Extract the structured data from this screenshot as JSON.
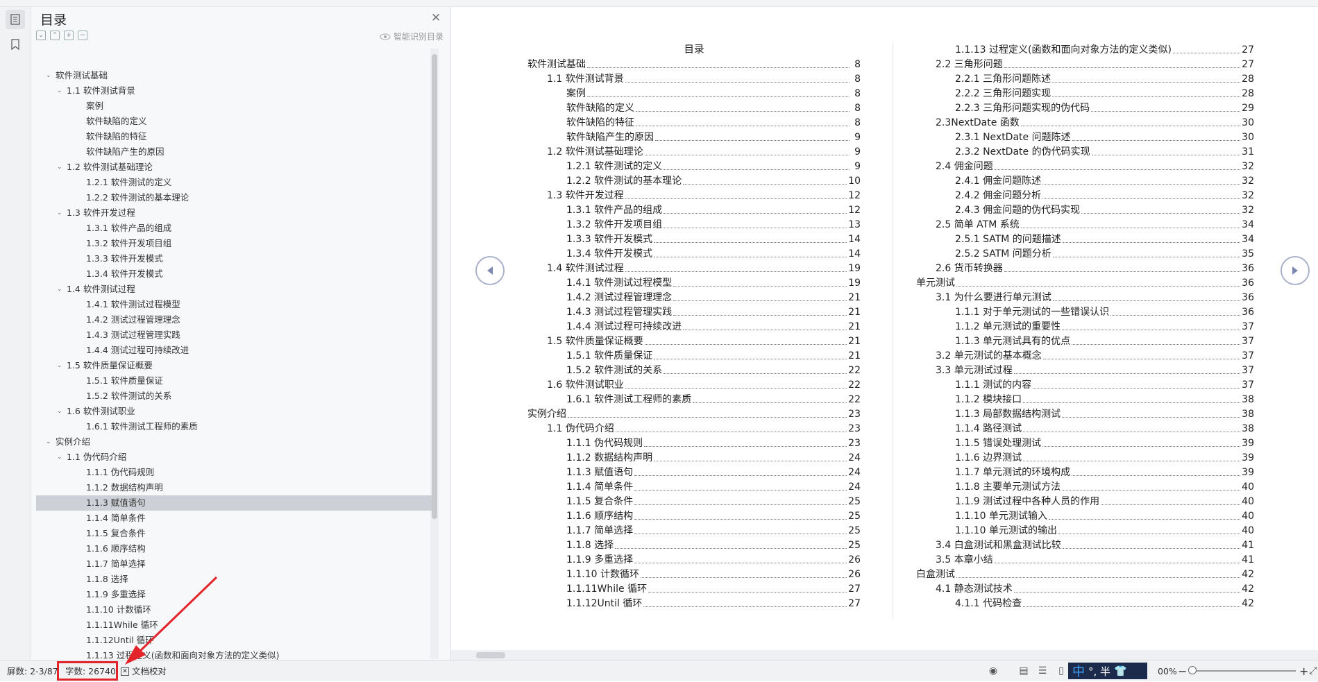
{
  "nav": {
    "title": "目录",
    "close_icon": "close-icon",
    "auto_label": "智能识别目录",
    "tools": [
      "collapse-all-icon",
      "expand-all-icon",
      "add-heading-icon",
      "remove-heading-icon"
    ],
    "items": [
      {
        "level": 0,
        "caret": "open",
        "label": "软件测试基础"
      },
      {
        "level": 1,
        "caret": "open",
        "label": "1.1 软件测试背景"
      },
      {
        "level": 2,
        "caret": "none",
        "label": "案例"
      },
      {
        "level": 2,
        "caret": "none",
        "label": "软件缺陷的定义"
      },
      {
        "level": 2,
        "caret": "none",
        "label": "软件缺陷的特征"
      },
      {
        "level": 2,
        "caret": "none",
        "label": "软件缺陷产生的原因"
      },
      {
        "level": 1,
        "caret": "open",
        "label": "1.2  软件测试基础理论"
      },
      {
        "level": 2,
        "caret": "none",
        "label": "1.2.1 软件测试的定义"
      },
      {
        "level": 2,
        "caret": "none",
        "label": "1.2.2 软件测试的基本理论"
      },
      {
        "level": 1,
        "caret": "open",
        "label": "1.3 软件开发过程"
      },
      {
        "level": 2,
        "caret": "none",
        "label": "1.3.1 软件产品的组成"
      },
      {
        "level": 2,
        "caret": "none",
        "label": "1.3.2 软件开发项目组"
      },
      {
        "level": 2,
        "caret": "none",
        "label": "1.3.3 软件开发模式"
      },
      {
        "level": 2,
        "caret": "none",
        "label": "1.3.4 软件开发模式"
      },
      {
        "level": 1,
        "caret": "open",
        "label": "1.4 软件测试过程"
      },
      {
        "level": 2,
        "caret": "none",
        "label": "1.4.1 软件测试过程模型"
      },
      {
        "level": 2,
        "caret": "none",
        "label": "1.4.2 测试过程管理理念"
      },
      {
        "level": 2,
        "caret": "none",
        "label": "1.4.3 测试过程管理实践"
      },
      {
        "level": 2,
        "caret": "none",
        "label": "1.4.4 测试过程可持续改进"
      },
      {
        "level": 1,
        "caret": "open",
        "label": "1.5 软件质量保证概要"
      },
      {
        "level": 2,
        "caret": "none",
        "label": "1.5.1 软件质量保证"
      },
      {
        "level": 2,
        "caret": "none",
        "label": "1.5.2 软件测试的关系"
      },
      {
        "level": 1,
        "caret": "open",
        "label": "1.6 软件测试职业"
      },
      {
        "level": 2,
        "caret": "none",
        "label": "1.6.1 软件测试工程师的素质"
      },
      {
        "level": 0,
        "caret": "open",
        "label": "实例介绍"
      },
      {
        "level": 1,
        "caret": "open",
        "label": "1.1 伪代码介绍"
      },
      {
        "level": 2,
        "caret": "none",
        "label": "1.1.1 伪代码规则"
      },
      {
        "level": 2,
        "caret": "none",
        "label": "1.1.2 数据结构声明"
      },
      {
        "level": 2,
        "caret": "none",
        "label": "1.1.3 赋值语句",
        "selected": true
      },
      {
        "level": 2,
        "caret": "none",
        "label": "1.1.4 简单条件"
      },
      {
        "level": 2,
        "caret": "none",
        "label": "1.1.5 复合条件"
      },
      {
        "level": 2,
        "caret": "none",
        "label": "1.1.6 顺序结构"
      },
      {
        "level": 2,
        "caret": "none",
        "label": "1.1.7 简单选择"
      },
      {
        "level": 2,
        "caret": "none",
        "label": "1.1.8 选择"
      },
      {
        "level": 2,
        "caret": "none",
        "label": "1.1.9 多重选择"
      },
      {
        "level": 2,
        "caret": "none",
        "label": "1.1.10 计数循环"
      },
      {
        "level": 2,
        "caret": "none",
        "label": "1.1.11While 循环"
      },
      {
        "level": 2,
        "caret": "none",
        "label": "1.1.12Until 循环"
      },
      {
        "level": 2,
        "caret": "none",
        "label": "1.1.13 过程定义(函数和面向对象方法的定义类似)"
      }
    ]
  },
  "page": {
    "toc_title": "目录",
    "left": [
      {
        "level": 0,
        "text": "软件测试基础",
        "page": "8"
      },
      {
        "level": 1,
        "text": "1.1 软件测试背景",
        "page": "8"
      },
      {
        "level": 2,
        "text": "案例",
        "page": "8"
      },
      {
        "level": 2,
        "text": "软件缺陷的定义",
        "page": "8"
      },
      {
        "level": 2,
        "text": "软件缺陷的特征",
        "page": "8"
      },
      {
        "level": 2,
        "text": "软件缺陷产生的原因",
        "page": "9"
      },
      {
        "level": 1,
        "text": "1.2  软件测试基础理论",
        "page": "9"
      },
      {
        "level": 2,
        "text": "1.2.1 软件测试的定义",
        "page": "9"
      },
      {
        "level": 2,
        "text": "1.2.2 软件测试的基本理论",
        "page": "10"
      },
      {
        "level": 1,
        "text": "1.3 软件开发过程",
        "page": "12"
      },
      {
        "level": 2,
        "text": "1.3.1 软件产品的组成",
        "page": "12"
      },
      {
        "level": 2,
        "text": "1.3.2 软件开发项目组",
        "page": "13"
      },
      {
        "level": 2,
        "text": "1.3.3 软件开发模式",
        "page": "14"
      },
      {
        "level": 2,
        "text": "1.3.4 软件开发模式",
        "page": "14"
      },
      {
        "level": 1,
        "text": "1.4 软件测试过程",
        "page": "19"
      },
      {
        "level": 2,
        "text": "1.4.1 软件测试过程模型",
        "page": "19"
      },
      {
        "level": 2,
        "text": "1.4.2 测试过程管理理念",
        "page": "21"
      },
      {
        "level": 2,
        "text": "1.4.3 测试过程管理实践",
        "page": "21"
      },
      {
        "level": 2,
        "text": "1.4.4 测试过程可持续改进",
        "page": "21"
      },
      {
        "level": 1,
        "text": "1.5 软件质量保证概要",
        "page": "21"
      },
      {
        "level": 2,
        "text": "1.5.1 软件质量保证",
        "page": "21"
      },
      {
        "level": 2,
        "text": "1.5.2 软件测试的关系",
        "page": "22"
      },
      {
        "level": 1,
        "text": "1.6 软件测试职业",
        "page": "22"
      },
      {
        "level": 2,
        "text": "1.6.1 软件测试工程师的素质",
        "page": "22"
      },
      {
        "level": 0,
        "text": "实例介绍",
        "page": "23"
      },
      {
        "level": 1,
        "text": "1.1 伪代码介绍",
        "page": "23"
      },
      {
        "level": 2,
        "text": "1.1.1 伪代码规则",
        "page": "23"
      },
      {
        "level": 2,
        "text": "1.1.2 数据结构声明",
        "page": "24"
      },
      {
        "level": 2,
        "text": "1.1.3 赋值语句",
        "page": "24"
      },
      {
        "level": 2,
        "text": "1.1.4 简单条件",
        "page": "24"
      },
      {
        "level": 2,
        "text": "1.1.5 复合条件",
        "page": "25"
      },
      {
        "level": 2,
        "text": "1.1.6 顺序结构",
        "page": "25"
      },
      {
        "level": 2,
        "text": "1.1.7 简单选择",
        "page": "25"
      },
      {
        "level": 2,
        "text": "1.1.8 选择",
        "page": "25"
      },
      {
        "level": 2,
        "text": "1.1.9 多重选择",
        "page": "26"
      },
      {
        "level": 2,
        "text": "1.1.10 计数循环",
        "page": "26"
      },
      {
        "level": 2,
        "text": "1.1.11While 循环",
        "page": "27"
      },
      {
        "level": 2,
        "text": "1.1.12Until 循环",
        "page": "27"
      }
    ],
    "right": [
      {
        "level": 2,
        "text": "1.1.13 过程定义(函数和面向对象方法的定义类似)",
        "page": "27"
      },
      {
        "level": 1,
        "text": "2.2 三角形问题",
        "page": "27"
      },
      {
        "level": 2,
        "text": "2.2.1 三角形问题陈述",
        "page": "28"
      },
      {
        "level": 2,
        "text": "2.2.2 三角形问题实现",
        "page": "28"
      },
      {
        "level": 2,
        "text": "2.2.3 三角形问题实现的伪代码",
        "page": "29"
      },
      {
        "level": 1,
        "text": "2.3NextDate 函数",
        "page": "30"
      },
      {
        "level": 2,
        "text": "2.3.1 NextDate  问题陈述",
        "page": "30"
      },
      {
        "level": 2,
        "text": "2.3.2 NextDate  的伪代码实现",
        "page": "31"
      },
      {
        "level": 1,
        "text": "2.4 佣金问题",
        "page": "32"
      },
      {
        "level": 2,
        "text": "2.4.1 佣金问题陈述",
        "page": "32"
      },
      {
        "level": 2,
        "text": "2.4.2  佣金问题分析",
        "page": "32"
      },
      {
        "level": 2,
        "text": "2.4.3  佣金问题的伪代码实现",
        "page": "32"
      },
      {
        "level": 1,
        "text": "2.5 简单 ATM 系统",
        "page": "34"
      },
      {
        "level": 2,
        "text": "2.5.1 SATM 的问题描述",
        "page": "34"
      },
      {
        "level": 2,
        "text": "2.5.2 SATM 问题分析",
        "page": "35"
      },
      {
        "level": 1,
        "text": "2.6 货币转换器",
        "page": "36"
      },
      {
        "level": 0,
        "text": "单元测试",
        "page": "36"
      },
      {
        "level": 1,
        "text": "3.1  为什么要进行单元测试",
        "page": "36"
      },
      {
        "level": 2,
        "text": "1.1.1 对于单元测试的一些错误认识",
        "page": "36"
      },
      {
        "level": 2,
        "text": "1.1.2 单元测试的重要性",
        "page": "37"
      },
      {
        "level": 2,
        "text": "1.1.3 单元测试具有的优点",
        "page": "37"
      },
      {
        "level": 1,
        "text": "3.2 单元测试的基本概念",
        "page": "37"
      },
      {
        "level": 1,
        "text": "3.3 单元测试过程",
        "page": "37"
      },
      {
        "level": 2,
        "text": "1.1.1 测试的内容",
        "page": "37"
      },
      {
        "level": 2,
        "text": "1.1.2 模块接口",
        "page": "38"
      },
      {
        "level": 2,
        "text": "1.1.3 局部数据结构测试",
        "page": "38"
      },
      {
        "level": 2,
        "text": "1.1.4 路径测试",
        "page": "38"
      },
      {
        "level": 2,
        "text": "1.1.5 错误处理测试",
        "page": "39"
      },
      {
        "level": 2,
        "text": "1.1.6 边界测试",
        "page": "39"
      },
      {
        "level": 2,
        "text": "1.1.7 单元测试的环境构成",
        "page": "39"
      },
      {
        "level": 2,
        "text": "1.1.8 主要单元测试方法",
        "page": "40"
      },
      {
        "level": 2,
        "text": "1.1.9 测试过程中各种人员的作用",
        "page": "40"
      },
      {
        "level": 2,
        "text": "1.1.10 单元测试输入",
        "page": "40"
      },
      {
        "level": 2,
        "text": "1.1.10 单元测试的输出",
        "page": "40"
      },
      {
        "level": 1,
        "text": "3.4 白盒测试和黑盒测试比较",
        "page": "41"
      },
      {
        "level": 1,
        "text": "3.5 本章小结",
        "page": "41"
      },
      {
        "level": 0,
        "text": "白盒测试",
        "page": "42"
      },
      {
        "level": 1,
        "text": "4.1 静态测试技术",
        "page": "42"
      },
      {
        "level": 2,
        "text": "4.1.1  代码检查",
        "page": "42"
      }
    ]
  },
  "status": {
    "pages": "屏数: 2-3/87",
    "word_count": "字数: 26740",
    "proofread": "文档校对",
    "ime_lang": "中",
    "ime_punct": "°, 半",
    "zoom": "00%",
    "zoom_minus": "−",
    "zoom_plus": "+"
  },
  "colors": {
    "highlight_box": "#e4242b",
    "arrow": "#e4242b",
    "ime_bg": "#1c2a4c"
  }
}
